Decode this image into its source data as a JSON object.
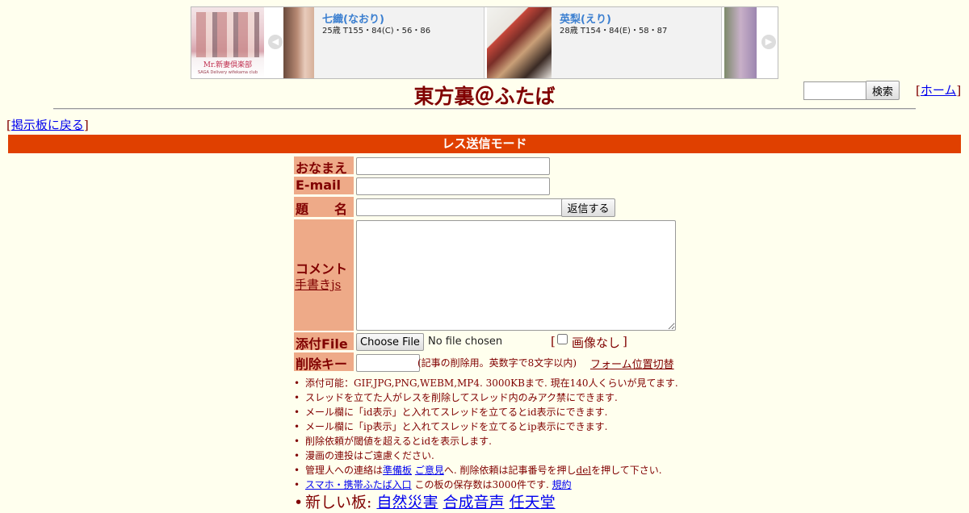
{
  "ad": {
    "logo_brand": "Mr.新妻倶楽部",
    "logo_brand_sub": "SAGA Delivery wifekama club",
    "prev_arrow": "◀",
    "next_arrow": "▶",
    "cards": [
      {
        "name": "七織(なおり)",
        "spec": "25歳 T155・84(C)・56・86"
      },
      {
        "name": "英梨(えり)",
        "spec": "28歳 T154・84(E)・58・87"
      }
    ]
  },
  "header": {
    "title": "東方裏＠ふたば",
    "search_button": "検索",
    "search_value": "",
    "home_link": "ホーム",
    "back_link": "掲示板に戻る",
    "bracket_open": "[",
    "bracket_close": "]"
  },
  "mode_bar": "レス送信モード",
  "form": {
    "name_label": "おなまえ",
    "email_label": "E-mail",
    "subject_label": "題　　名",
    "submit_button": "返信する",
    "comment_label": "コメント",
    "handwriting_link": "手書きjs",
    "file_label": "添付File",
    "choose_file_button": "Choose File",
    "no_file_text": "No file chosen",
    "no_image_label": "画像なし",
    "no_image_checked": false,
    "delete_key_label": "削除キー",
    "delete_key_note": "(記事の削除用。英数字で8文字以内)",
    "form_position_link": "フォーム位置切替"
  },
  "notes": {
    "n1": "添付可能：GIF,JPG,PNG,WEBM,MP4. 3000KBまで. 現在140人くらいが見てます.",
    "n2": "スレッドを立てた人がレスを削除してスレッド内のみアク禁にできます.",
    "n3": "メール欄に「id表示」と入れてスレッドを立てるとid表示にできます.",
    "n4": "メール欄に「ip表示」と入れてスレッドを立てるとip表示にできます.",
    "n5": "削除依頼が閾値を超えるとidを表示します.",
    "n6": "漫画の連投はご遠慮ください.",
    "n7_pre": "管理人への連絡は",
    "n7_link1": "準備板",
    "n7_link2": "ご意見",
    "n7_mid": "へ. 削除依頼は記事番号を押し",
    "n7_del": "del",
    "n7_post": "を押して下さい.",
    "n8_link": "スマホ・携帯ふたば入口",
    "n8_text": " この板の保存数は3000件です.",
    "n8_rules": "規約",
    "new_boards_label": "新しい板:",
    "new_boards": [
      "自然災害",
      "合成音声",
      "任天堂"
    ]
  },
  "colors": {
    "background": "#ffffee",
    "text": "#800000",
    "mode_bar": "#e04000",
    "label_bg": "#eeaa88",
    "link": "#0000ee"
  }
}
